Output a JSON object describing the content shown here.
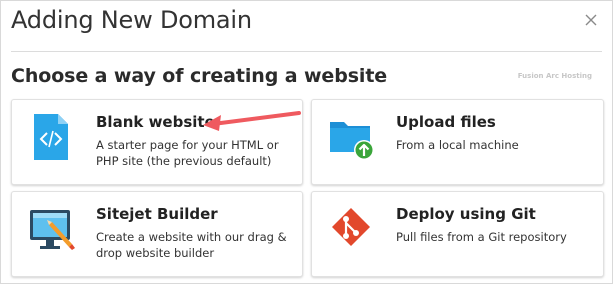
{
  "dialog": {
    "title": "Adding New Domain",
    "close_icon": "close-icon"
  },
  "section": {
    "subtitle": "Choose a way of creating a website",
    "watermark": "Fusion Arc Hosting"
  },
  "cards": [
    {
      "id": "blank",
      "title": "Blank website",
      "description": "A starter page for your HTML or PHP site (the previous default)",
      "icon": "code-file-icon"
    },
    {
      "id": "upload",
      "title": "Upload files",
      "description": "From a local machine",
      "icon": "folder-upload-icon"
    },
    {
      "id": "sitejet",
      "title": "Sitejet Builder",
      "description": "Create a website with our drag & drop website builder",
      "icon": "sitejet-builder-icon"
    },
    {
      "id": "git",
      "title": "Deploy using Git",
      "description": "Pull files from a Git repository",
      "icon": "git-icon"
    }
  ],
  "colors": {
    "accent_blue": "#2aa6e8",
    "upload_green": "#3aa53a",
    "git_red": "#e2482c",
    "annotation_arrow": "#ef5a5f"
  }
}
